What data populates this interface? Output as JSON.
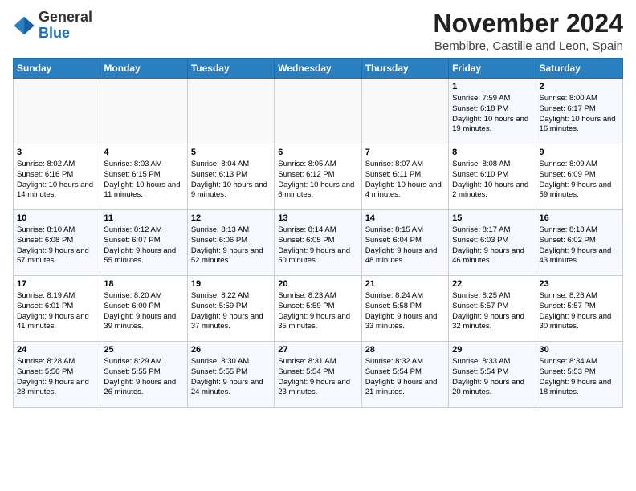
{
  "logo": {
    "general": "General",
    "blue": "Blue"
  },
  "title": "November 2024",
  "location": "Bembibre, Castille and Leon, Spain",
  "days_of_week": [
    "Sunday",
    "Monday",
    "Tuesday",
    "Wednesday",
    "Thursday",
    "Friday",
    "Saturday"
  ],
  "weeks": [
    [
      {
        "day": "",
        "content": ""
      },
      {
        "day": "",
        "content": ""
      },
      {
        "day": "",
        "content": ""
      },
      {
        "day": "",
        "content": ""
      },
      {
        "day": "",
        "content": ""
      },
      {
        "day": "1",
        "content": "Sunrise: 7:59 AM\nSunset: 6:18 PM\nDaylight: 10 hours and 19 minutes."
      },
      {
        "day": "2",
        "content": "Sunrise: 8:00 AM\nSunset: 6:17 PM\nDaylight: 10 hours and 16 minutes."
      }
    ],
    [
      {
        "day": "3",
        "content": "Sunrise: 8:02 AM\nSunset: 6:16 PM\nDaylight: 10 hours and 14 minutes."
      },
      {
        "day": "4",
        "content": "Sunrise: 8:03 AM\nSunset: 6:15 PM\nDaylight: 10 hours and 11 minutes."
      },
      {
        "day": "5",
        "content": "Sunrise: 8:04 AM\nSunset: 6:13 PM\nDaylight: 10 hours and 9 minutes."
      },
      {
        "day": "6",
        "content": "Sunrise: 8:05 AM\nSunset: 6:12 PM\nDaylight: 10 hours and 6 minutes."
      },
      {
        "day": "7",
        "content": "Sunrise: 8:07 AM\nSunset: 6:11 PM\nDaylight: 10 hours and 4 minutes."
      },
      {
        "day": "8",
        "content": "Sunrise: 8:08 AM\nSunset: 6:10 PM\nDaylight: 10 hours and 2 minutes."
      },
      {
        "day": "9",
        "content": "Sunrise: 8:09 AM\nSunset: 6:09 PM\nDaylight: 9 hours and 59 minutes."
      }
    ],
    [
      {
        "day": "10",
        "content": "Sunrise: 8:10 AM\nSunset: 6:08 PM\nDaylight: 9 hours and 57 minutes."
      },
      {
        "day": "11",
        "content": "Sunrise: 8:12 AM\nSunset: 6:07 PM\nDaylight: 9 hours and 55 minutes."
      },
      {
        "day": "12",
        "content": "Sunrise: 8:13 AM\nSunset: 6:06 PM\nDaylight: 9 hours and 52 minutes."
      },
      {
        "day": "13",
        "content": "Sunrise: 8:14 AM\nSunset: 6:05 PM\nDaylight: 9 hours and 50 minutes."
      },
      {
        "day": "14",
        "content": "Sunrise: 8:15 AM\nSunset: 6:04 PM\nDaylight: 9 hours and 48 minutes."
      },
      {
        "day": "15",
        "content": "Sunrise: 8:17 AM\nSunset: 6:03 PM\nDaylight: 9 hours and 46 minutes."
      },
      {
        "day": "16",
        "content": "Sunrise: 8:18 AM\nSunset: 6:02 PM\nDaylight: 9 hours and 43 minutes."
      }
    ],
    [
      {
        "day": "17",
        "content": "Sunrise: 8:19 AM\nSunset: 6:01 PM\nDaylight: 9 hours and 41 minutes."
      },
      {
        "day": "18",
        "content": "Sunrise: 8:20 AM\nSunset: 6:00 PM\nDaylight: 9 hours and 39 minutes."
      },
      {
        "day": "19",
        "content": "Sunrise: 8:22 AM\nSunset: 5:59 PM\nDaylight: 9 hours and 37 minutes."
      },
      {
        "day": "20",
        "content": "Sunrise: 8:23 AM\nSunset: 5:59 PM\nDaylight: 9 hours and 35 minutes."
      },
      {
        "day": "21",
        "content": "Sunrise: 8:24 AM\nSunset: 5:58 PM\nDaylight: 9 hours and 33 minutes."
      },
      {
        "day": "22",
        "content": "Sunrise: 8:25 AM\nSunset: 5:57 PM\nDaylight: 9 hours and 32 minutes."
      },
      {
        "day": "23",
        "content": "Sunrise: 8:26 AM\nSunset: 5:57 PM\nDaylight: 9 hours and 30 minutes."
      }
    ],
    [
      {
        "day": "24",
        "content": "Sunrise: 8:28 AM\nSunset: 5:56 PM\nDaylight: 9 hours and 28 minutes."
      },
      {
        "day": "25",
        "content": "Sunrise: 8:29 AM\nSunset: 5:55 PM\nDaylight: 9 hours and 26 minutes."
      },
      {
        "day": "26",
        "content": "Sunrise: 8:30 AM\nSunset: 5:55 PM\nDaylight: 9 hours and 24 minutes."
      },
      {
        "day": "27",
        "content": "Sunrise: 8:31 AM\nSunset: 5:54 PM\nDaylight: 9 hours and 23 minutes."
      },
      {
        "day": "28",
        "content": "Sunrise: 8:32 AM\nSunset: 5:54 PM\nDaylight: 9 hours and 21 minutes."
      },
      {
        "day": "29",
        "content": "Sunrise: 8:33 AM\nSunset: 5:54 PM\nDaylight: 9 hours and 20 minutes."
      },
      {
        "day": "30",
        "content": "Sunrise: 8:34 AM\nSunset: 5:53 PM\nDaylight: 9 hours and 18 minutes."
      }
    ]
  ]
}
